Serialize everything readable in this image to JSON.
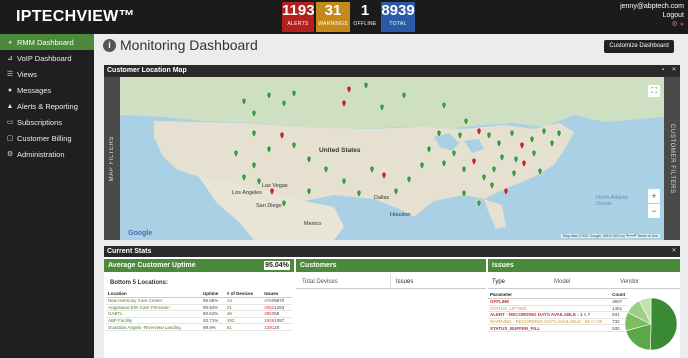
{
  "brand": {
    "name": "IPTECHVIEW™"
  },
  "counters": {
    "alerts": {
      "value": "1193",
      "label": "ALERTS",
      "color": "#b32020"
    },
    "warnings": {
      "value": "31",
      "label": "WARNINGS",
      "color": "#c48a1a"
    },
    "offline": {
      "value": "1",
      "label": "OFFLINE"
    },
    "total": {
      "value": "8939",
      "label": "TOTAL",
      "color": "#2c5aa8"
    }
  },
  "user": {
    "email": "jenny@abptech.com",
    "logout": "Logout"
  },
  "sidebar": {
    "items": [
      {
        "label": "RMM Dashboard",
        "icon": "dashboard-icon",
        "active": true
      },
      {
        "label": "VoIP Dashboard",
        "icon": "chart-icon"
      },
      {
        "label": "Views",
        "icon": "list-icon"
      },
      {
        "label": "Messages",
        "icon": "chat-icon"
      },
      {
        "label": "Alerts & Reporting",
        "icon": "bell-icon"
      },
      {
        "label": "Subscriptions",
        "icon": "card-icon"
      },
      {
        "label": "Customer Billing",
        "icon": "billing-icon"
      },
      {
        "label": "Administration",
        "icon": "gear-icon"
      }
    ]
  },
  "page": {
    "title": "Monitoring Dashboard",
    "customize_label": "Customize Dashboard"
  },
  "map": {
    "title": "Customer Location Map",
    "left_tab": "MAP FILTERS",
    "right_tab": "CUSTOMER FILTERS",
    "labels": {
      "country": "United States",
      "mexico": "Mexico",
      "ocean": "North Atlantic Ocean",
      "las_vegas": "Las Vegas",
      "san_diego": "San Diego",
      "dallas": "Dallas",
      "houston": "Houston",
      "los_angeles": "Los Angeles"
    },
    "google": "Google",
    "attribution": "Map data ©2021 Google, INEGI   500 km ┗━━━┛   Terms of Use",
    "zoom_in": "+",
    "zoom_out": "−"
  },
  "stats": {
    "title": "Current Stats",
    "uptime": {
      "title": "Average Customer Uptime",
      "value": "95.04%",
      "bottom_label": "Bottom 5 Locations:",
      "columns": [
        "Location",
        "Uptime",
        "# of Devices",
        "Issues"
      ],
      "rows": [
        {
          "location": "New Harmony Care Center",
          "uptime": "99.95%",
          "devices": "14",
          "issues_a": "4760",
          "issues_b": "8870"
        },
        {
          "location": "Augustana Elm Care Princeton",
          "uptime": "90.94%",
          "devices": "21",
          "issues_a": "3352",
          "issues_b": "1263"
        },
        {
          "location": "GABTL",
          "uptime": "80.64%",
          "devices": "46",
          "issues_a": "3850",
          "issues_b": "58"
        },
        {
          "location": "ABP Facility",
          "uptime": "20.71%",
          "devices": "192",
          "issues_a": "1926",
          "issues_b": "1057"
        },
        {
          "location": "Guardian Angels -Riverview Landing",
          "uptime": "99.9%",
          "devices": "51",
          "issues_a": "1291",
          "issues_b": "20"
        }
      ]
    },
    "customers": {
      "title": "Customers",
      "tabs": [
        "Total Devices",
        "Issues"
      ]
    },
    "issues": {
      "title": "Issues",
      "tabs": [
        "Type",
        "Model",
        "Vendor"
      ],
      "columns": [
        "Parameter",
        "Count"
      ],
      "rows": [
        {
          "param": "OFFLINE",
          "count": "3607"
        },
        {
          "param": "STATUS_UPTIME",
          "count": "1461"
        },
        {
          "param": "ALERT - RECORDING DAYS AVAILABLE : 1 < 7",
          "count": "831"
        },
        {
          "param": "WARNING - RECORDING DAYS AVAILABLE : 59 << 59",
          "count": "732"
        },
        {
          "param": "STATUS_BUFFER_FILL",
          "count": "530"
        }
      ]
    }
  }
}
